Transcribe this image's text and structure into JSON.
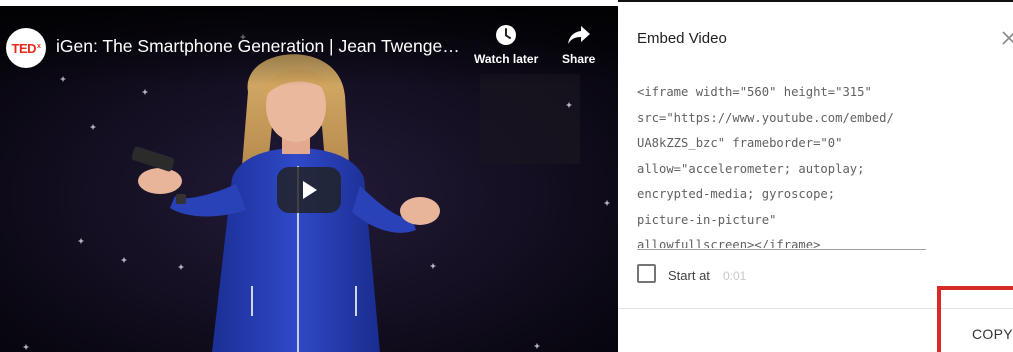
{
  "video": {
    "channel_logo_text": "TED",
    "channel_logo_mark": "x",
    "title": "iGen: The Smartphone Generation | Jean Twenge | ...",
    "watch_later_label": "Watch later",
    "share_label": "Share",
    "icons": [
      "clock-icon",
      "share-arrow-icon",
      "play-icon"
    ],
    "colors": {
      "play_button_bg": "#212121",
      "logo_red": "#e62b1e"
    }
  },
  "embed_panel": {
    "title": "Embed Video",
    "code": "<iframe width=\"560\" height=\"315\"\nsrc=\"https://www.youtube.com/embed/\nUA8kZZS_bzc\" frameborder=\"0\"\nallow=\"accelerometer; autoplay;\nencrypted-media; gyroscope;\npicture-in-picture\"\nallowfullscreen></iframe>",
    "start_at_label": "Start at",
    "start_at_time": "0:01",
    "start_at_checked": false,
    "copy_label": "COPY",
    "colors": {
      "highlight": "#d92a2a"
    }
  }
}
